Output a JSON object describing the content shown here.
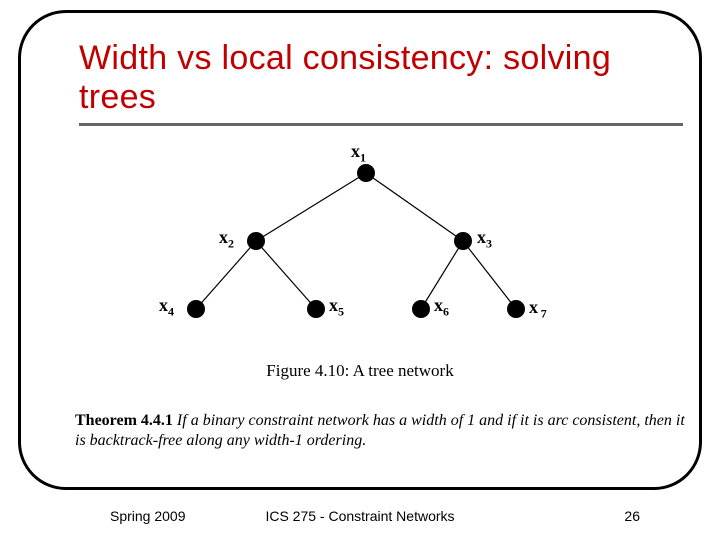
{
  "title": "Width vs local consistency: solving trees",
  "figure": {
    "caption": "Figure 4.10: A tree network",
    "nodes": {
      "x1": "x",
      "x1_sub": "1",
      "x2": "x",
      "x2_sub": "2",
      "x3": "x",
      "x3_sub": "3",
      "x4": "x",
      "x4_sub": "4",
      "x5": "x",
      "x5_sub": "5",
      "x6": "x",
      "x6_sub": "6",
      "x7": "x",
      "x7_sub": "7"
    }
  },
  "theorem": {
    "label": "Theorem 4.4.1",
    "body": "If a binary constraint network has a width of 1 and if it is arc consistent, then it is backtrack-free along any width-1 ordering."
  },
  "footer": {
    "left": "Spring 2009",
    "center": "ICS 275 - Constraint Networks",
    "right": "26"
  }
}
